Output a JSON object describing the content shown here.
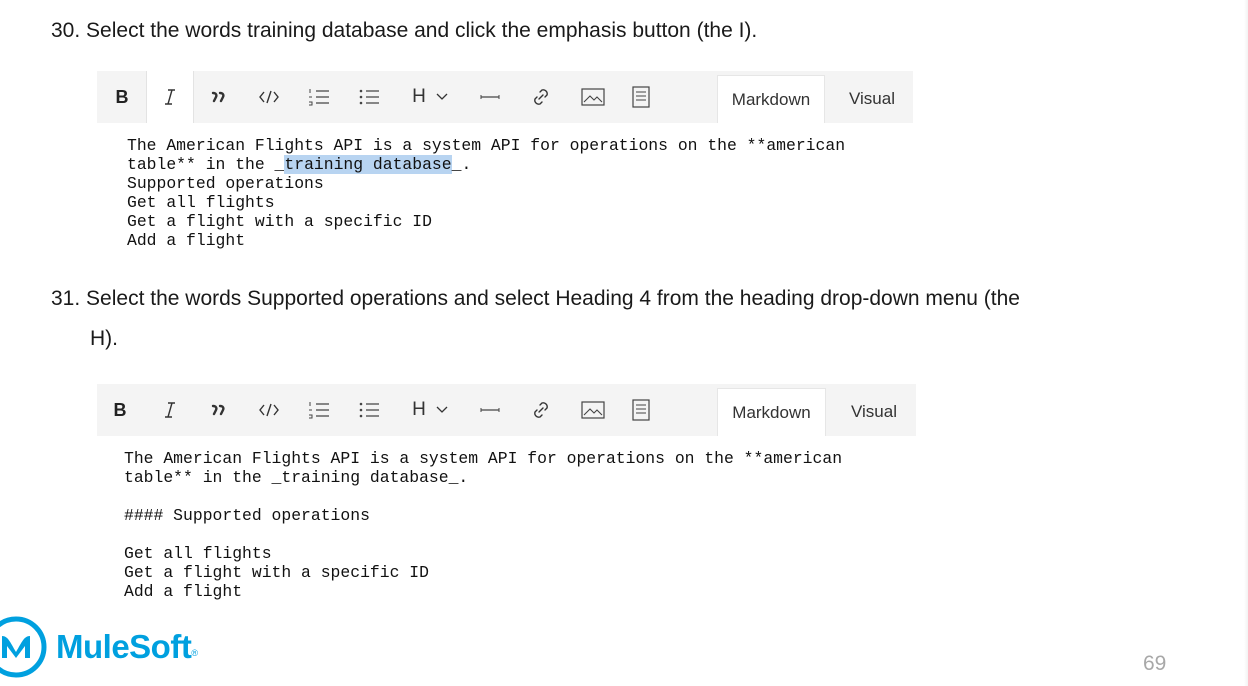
{
  "steps": [
    {
      "number": "30.",
      "text": "Select the words training database and click the emphasis button (the I)."
    },
    {
      "number": "31.",
      "text_line1": "Select the words Supported operations and select Heading 4 from the heading drop-down menu (the",
      "text_line2": "H)."
    }
  ],
  "toolbar": {
    "bold_label": "B",
    "heading_label": "H",
    "tab_markdown": "Markdown",
    "tab_visual": "Visual",
    "icons": [
      "italic-icon",
      "quote-icon",
      "code-icon",
      "ordered-list-icon",
      "unordered-list-icon",
      "heading-dropdown-icon",
      "horizontal-rule-icon",
      "link-icon",
      "image-icon",
      "table-icon"
    ]
  },
  "editor1": {
    "line1": "The American Flights API is a system API for operations on the **american",
    "line2_prefix": "table** in the _",
    "line2_selected": "training database",
    "line2_suffix": "_.",
    "line3": "Supported operations",
    "line4": "Get all flights",
    "line5": "Get a flight with a specific ID",
    "line6": "Add a flight"
  },
  "editor2": {
    "line1": "The American Flights API is a system API for operations on the **american",
    "line2": "table** in the _training database_.",
    "line3": "",
    "line4": "#### Supported operations",
    "line5": "",
    "line6": "Get all flights",
    "line7": "Get a flight with a specific ID",
    "line8": "Add a flight"
  },
  "footer": {
    "logo_text": "MuleSoft",
    "trademark": "®",
    "page_number": "69"
  },
  "colors": {
    "brand": "#00a0df",
    "selection": "#b8d4f1",
    "toolbar_bg": "#f4f4f4"
  }
}
